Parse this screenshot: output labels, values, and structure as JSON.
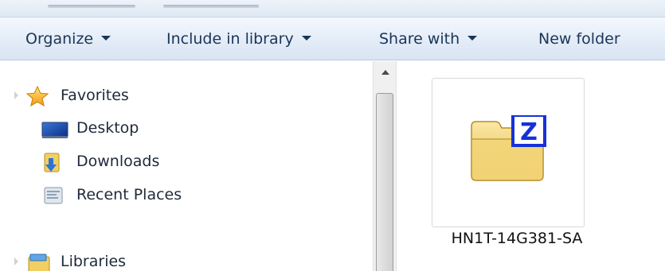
{
  "toolbar": {
    "organize": "Organize",
    "include_in_library": "Include in library",
    "share_with": "Share with",
    "new_folder": "New folder"
  },
  "nav": {
    "favorites": "Favorites",
    "desktop": "Desktop",
    "downloads": "Downloads",
    "recent_places": "Recent Places",
    "libraries": "Libraries"
  },
  "files": [
    {
      "name": "HN1T-14G381-SA",
      "icon": "zipped-folder-icon",
      "badge": "Z"
    }
  ],
  "colors": {
    "toolbar_text": "#1b3558",
    "folder_yellow": "#f2d67a",
    "badge_blue": "#1631d9",
    "star_gold": "#f6b21c"
  }
}
